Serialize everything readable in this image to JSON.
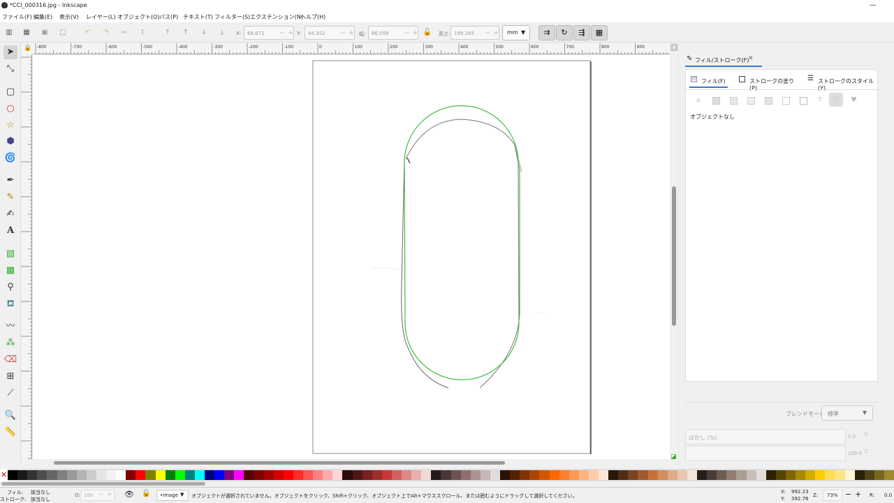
{
  "window": {
    "title": "*CCI_000316.jpg - Inkscape",
    "minimize": "—",
    "maximize": "☐"
  },
  "menu": [
    "ファイル(F)",
    "編集(E)",
    "表示(V)",
    "レイヤー(L)",
    "オブジェクト(O)",
    "パス(P)",
    "テキスト(T)",
    "フィルター(S)",
    "エクステンション(N)",
    "ヘルプ(H)"
  ],
  "toolbar": {
    "x_label": "X:",
    "x_value": "68.671",
    "y_label": "Y:",
    "y_value": "44.352",
    "w_label": "幅:",
    "w_value": "86.059",
    "h_label": "高さ:",
    "h_value": "199.345",
    "unit": "mm",
    "minus": "−",
    "plus": "+"
  },
  "ruler": {
    "h_ticks": [
      "-800",
      "-700",
      "-600",
      "-500",
      "-400",
      "-300",
      "-200",
      "-100",
      "0",
      "100",
      "200",
      "300",
      "400",
      "500",
      "600",
      "700",
      "800",
      "900"
    ]
  },
  "panel": {
    "tab_title": "フィル/ストローク(F)",
    "close": "✕",
    "subtabs": [
      "フィル(F)",
      "ストロークの塗り(P)",
      "ストロークのスタイル(Y)"
    ],
    "paint_question": "?",
    "no_object": "オブジェクトなし",
    "blend_label": "ブレンドモード:",
    "blend_value": "標準",
    "blur_label": "ぼかし (%)",
    "blur_value": "0.0",
    "opacity_value": "100.0"
  },
  "palette": {
    "colors": [
      "#000000",
      "#1a1a1a",
      "#333333",
      "#4d4d4d",
      "#666666",
      "#808080",
      "#999999",
      "#b3b3b3",
      "#cccccc",
      "#e6e6e6",
      "#f2f2f2",
      "#ffffff",
      "#800000",
      "#ff0000",
      "#808000",
      "#ffff00",
      "#008000",
      "#00ff00",
      "#008080",
      "#00ffff",
      "#000080",
      "#0000ff",
      "#800080",
      "#ff00ff",
      "#550000",
      "#800000",
      "#aa0000",
      "#d40000",
      "#ff0000",
      "#ff2a2a",
      "#ff5555",
      "#ff8080",
      "#ffaaaa",
      "#ffd5d5",
      "#280b0b",
      "#501616",
      "#782121",
      "#a02c2c",
      "#c83737",
      "#d35f5f",
      "#de8787",
      "#e9afaf",
      "#f4d7d7",
      "#241c1c",
      "#483737",
      "#6c5353",
      "#916f6f",
      "#ac9393",
      "#c8b7b7",
      "#e3dbdb",
      "#2b1100",
      "#552200",
      "#803300",
      "#aa4400",
      "#d45500",
      "#ff6600",
      "#ff7f2a",
      "#ff9955",
      "#ffb380",
      "#ffccaa",
      "#ffe6d5",
      "#28170b",
      "#502d16",
      "#784421",
      "#a05a2c",
      "#c87137",
      "#d38d5f",
      "#deaa87",
      "#e9c6af",
      "#f4e3d7",
      "#241f1c",
      "#483e37",
      "#6c5d53",
      "#917c6f",
      "#ac9d93",
      "#c8beb7",
      "#e3dedb",
      "#2b2200",
      "#554400",
      "#806600",
      "#aa8800",
      "#d4aa00",
      "#ffcc00",
      "#ffdd55",
      "#ffe680",
      "#fff6d5",
      "#28220b",
      "#504416",
      "#786721",
      "#a0892c"
    ]
  },
  "status": {
    "fill_label": "フィル:",
    "fill_value": "該当なし",
    "stroke_label": "ストローク:",
    "stroke_value": "該当なし",
    "opacity_label": "O:",
    "opacity_value": "100",
    "layer": "•Image",
    "message": "オブジェクトが選択されていません。オブジェクトをクリック、Shift+クリック、オブジェクト上でAlt+マウススクロール、または囲むようにドラッグして選択してください。",
    "x_label": "X:",
    "x_value": "992.23",
    "y_label": "Y:",
    "y_value": "392.76",
    "zoom_label": "Z:",
    "zoom_value": "73%",
    "zoom_minus": "−",
    "zoom_plus": "+",
    "rot_label": "R:",
    "rot_value": "0.0"
  },
  "colors": {
    "accent": "#3a78c8",
    "path_green": "#3fbf3f",
    "pencil_gray": "#666666"
  }
}
